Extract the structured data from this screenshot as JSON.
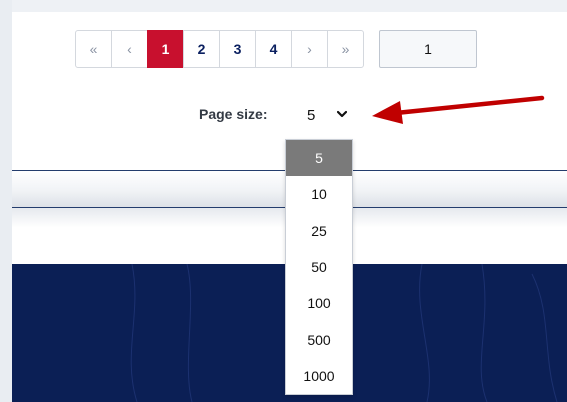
{
  "pager": {
    "first": "«",
    "prev": "‹",
    "pages": [
      "1",
      "2",
      "3",
      "4"
    ],
    "active_page": "1",
    "next": "›",
    "last": "»",
    "goto_value": "1"
  },
  "page_size": {
    "label": "Page size:",
    "selected": "5",
    "options": [
      "5",
      "10",
      "25",
      "50",
      "100",
      "500",
      "1000"
    ]
  },
  "colors": {
    "accent": "#c8102e",
    "navy": "#0b1f55",
    "arrow": "#c00000"
  },
  "icons": {
    "select_chevron": "chevron-down-icon",
    "annotation": "arrow-left-icon"
  }
}
